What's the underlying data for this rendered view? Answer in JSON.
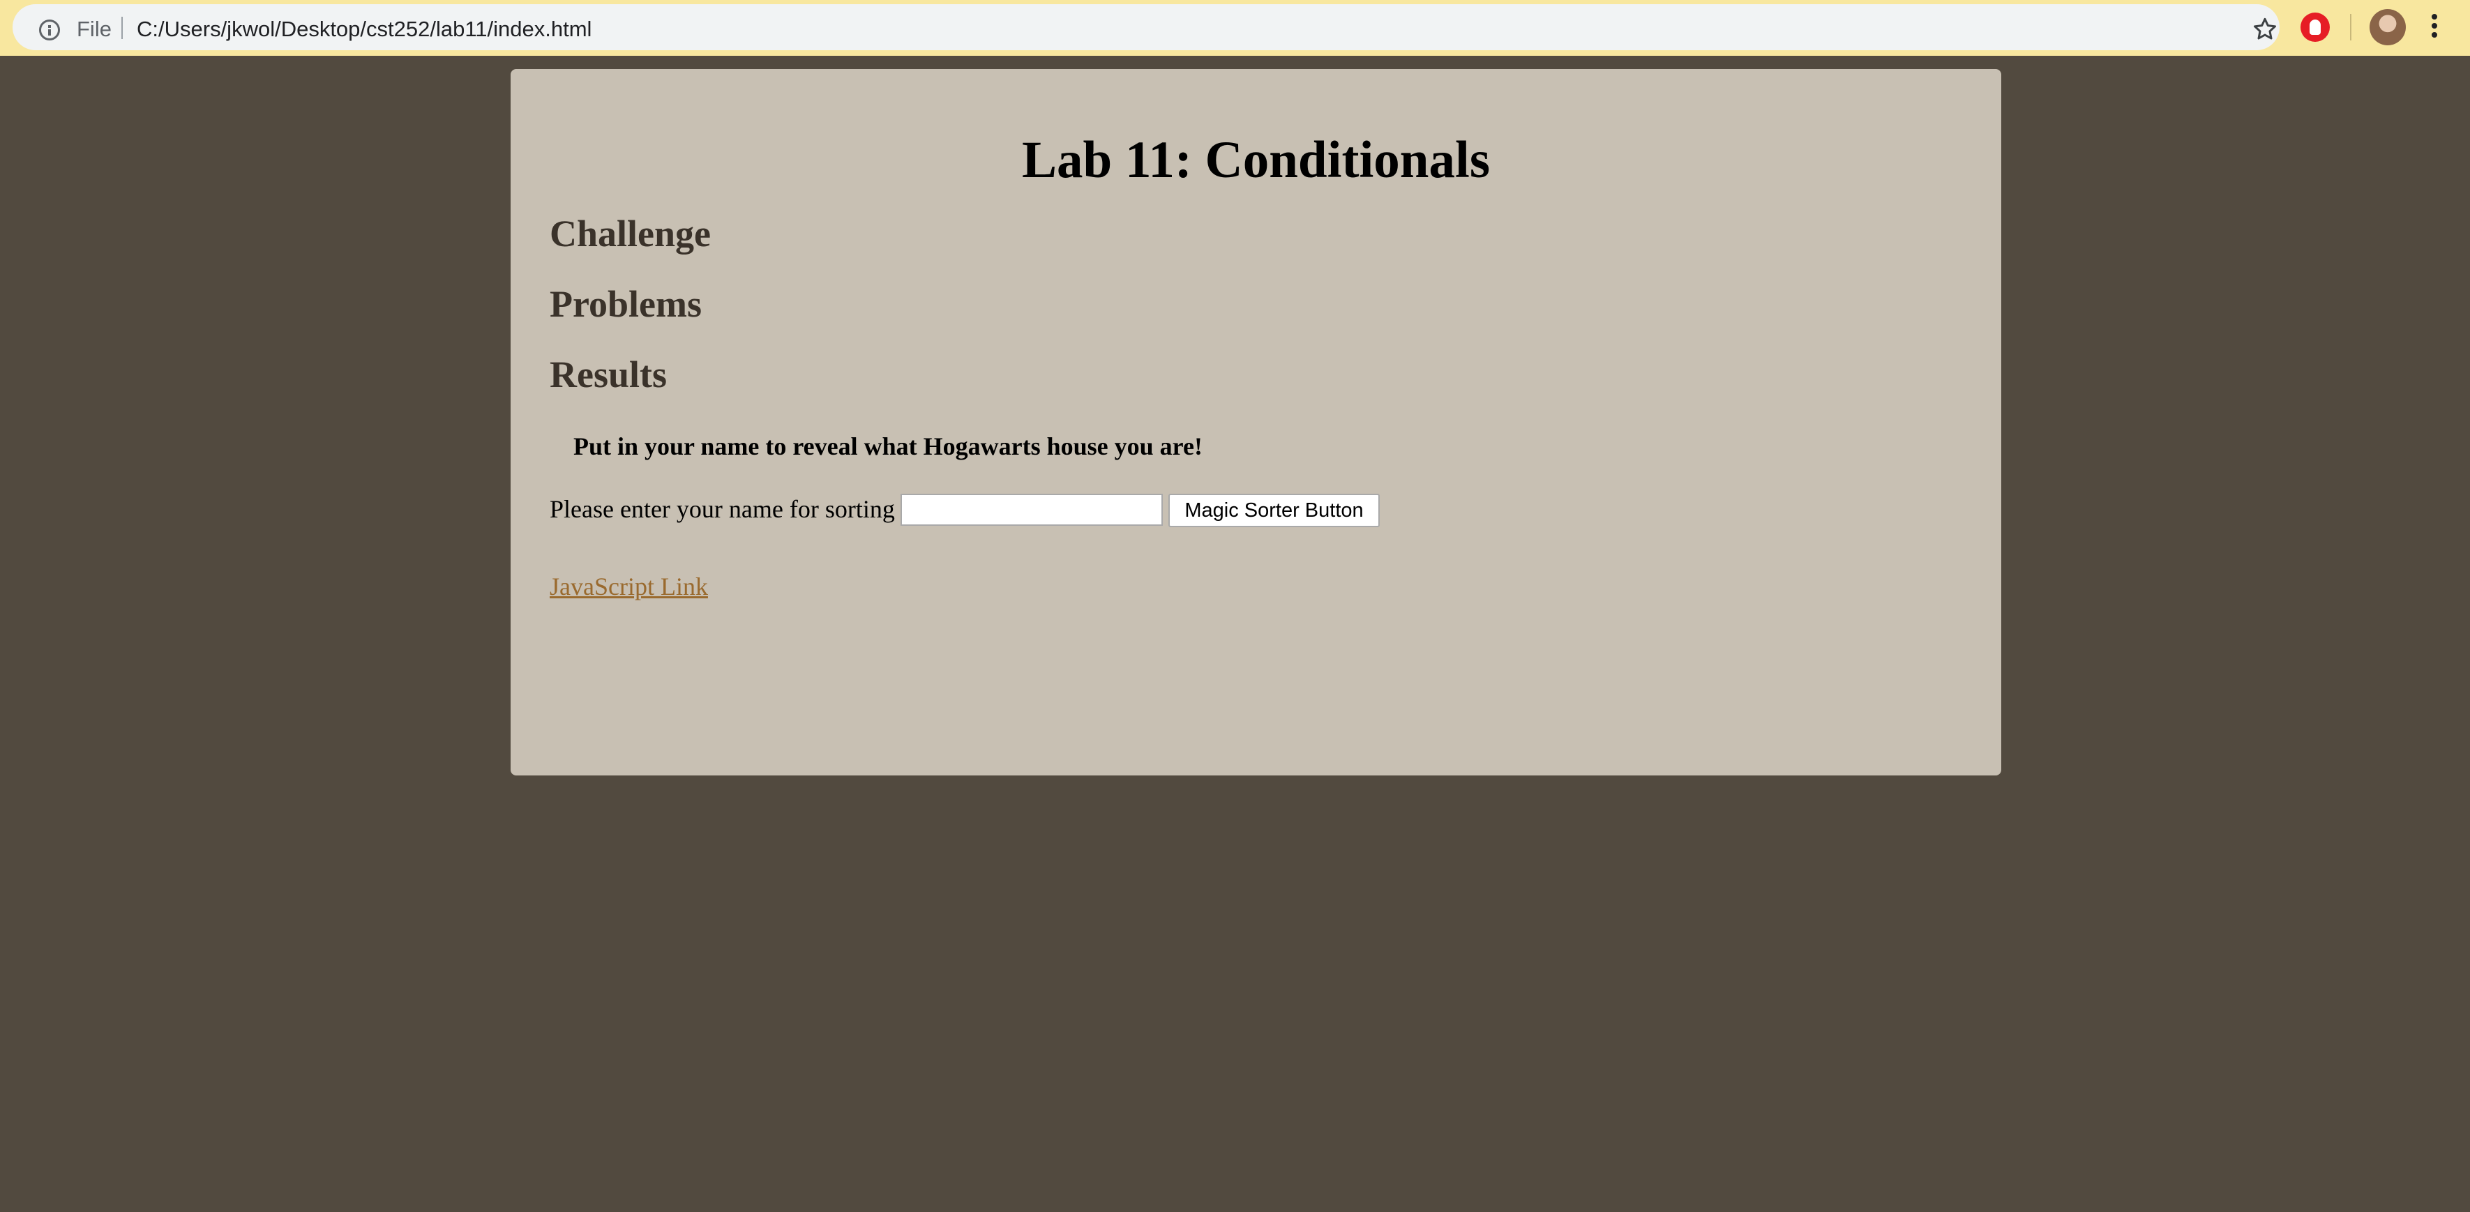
{
  "browser": {
    "scheme_label": "File",
    "url": "C:/Users/jkwol/Desktop/cst252/lab11/index.html",
    "icons": {
      "info": "info-icon",
      "bookmark": "star-icon",
      "extension": "adblock-extension-icon",
      "profile": "avatar",
      "menu": "kebab-menu-icon"
    },
    "colors": {
      "bar": "#f8e79f",
      "omnibox": "#f1f3f4"
    }
  },
  "page": {
    "title": "Lab 11: Conditionals",
    "sections": [
      "Challenge",
      "Problems",
      "Results"
    ],
    "prompt": "Put in your name to reveal what Hogawarts house you are!",
    "name_label": "Please enter your name for sorting",
    "name_input_value": "",
    "button_label": "Magic Sorter Button",
    "link_label": "JavaScript Link",
    "colors": {
      "background": "#524a3f",
      "panel": "#c8c0b3",
      "heading": "#3a322a",
      "link": "#9a6a2e"
    }
  }
}
